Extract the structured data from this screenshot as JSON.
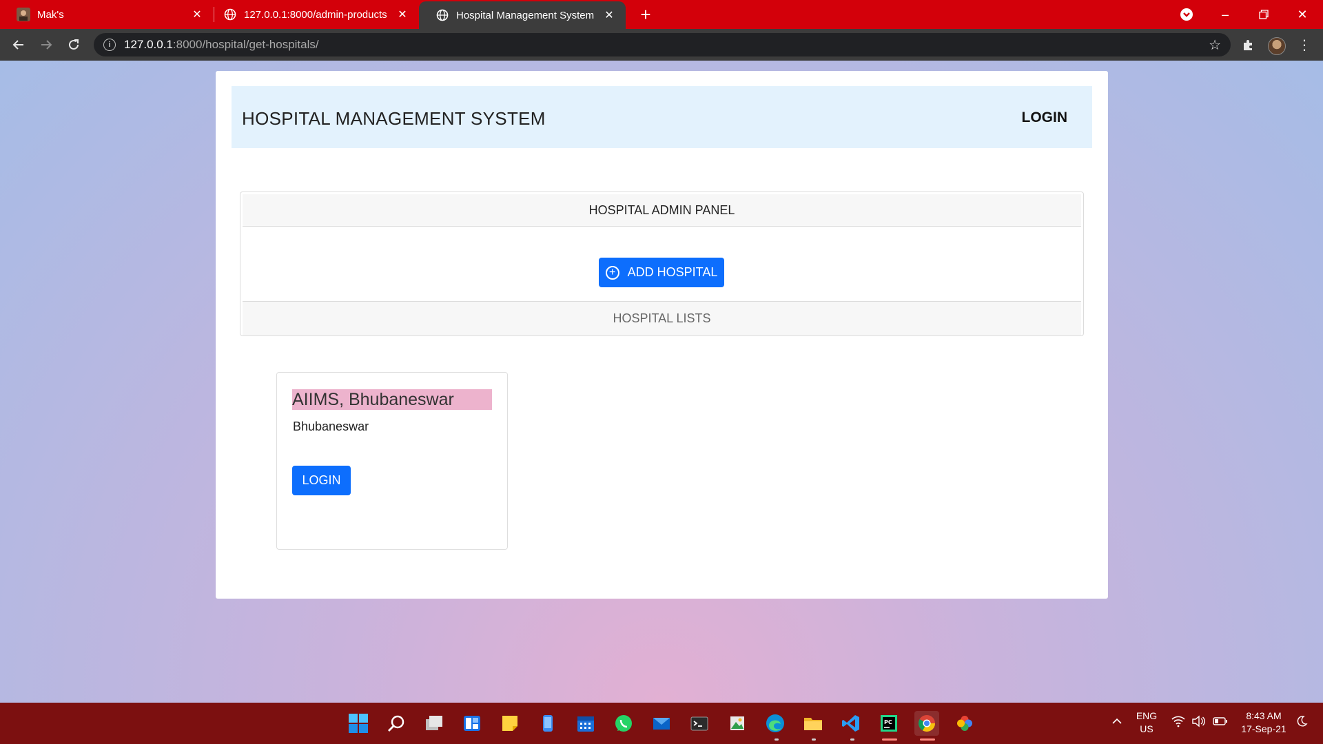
{
  "browser": {
    "tabs": [
      {
        "title": "Mak's",
        "favicon": "user-avatar-icon",
        "active": false
      },
      {
        "title": "127.0.0.1:8000/admin-products",
        "favicon": "globe-icon",
        "active": false
      },
      {
        "title": "Hospital Management System",
        "favicon": "globe-icon",
        "active": true
      }
    ],
    "address": {
      "host": "127.0.0.1",
      "path": ":8000/hospital/get-hospitals/"
    },
    "colors": {
      "tabstrip": "#d3000a",
      "toolbar": "#3c3c3c"
    }
  },
  "page": {
    "brand": "HOSPITAL MANAGEMENT SYSTEM",
    "nav_login": "LOGIN",
    "panel_title": "HOSPITAL ADMIN PANEL",
    "add_button": "ADD HOSPITAL",
    "lists_label": "HOSPITAL LISTS",
    "hospitals": [
      {
        "name": "AIIMS, Bhubaneswar",
        "city": "Bhubaneswar",
        "login_label": "LOGIN"
      }
    ],
    "colors": {
      "primary": "#0d6efd",
      "navbar": "#e3f2fd",
      "highlight": "#edb3cd"
    }
  },
  "taskbar": {
    "apps": [
      "start-icon",
      "search-icon",
      "task-view-icon",
      "widgets-icon",
      "sticky-notes-icon",
      "phone-app-icon",
      "calendar-icon",
      "whatsapp-icon",
      "mail-icon",
      "terminal-icon",
      "photo-editor-icon",
      "edge-icon",
      "file-explorer-icon",
      "vscode-icon",
      "pycharm-icon",
      "chrome-icon",
      "pinwheel-icon"
    ],
    "lang_line1": "ENG",
    "lang_line2": "US",
    "time": "8:43 AM",
    "date": "17-Sep-21",
    "color": "#7c1010"
  }
}
